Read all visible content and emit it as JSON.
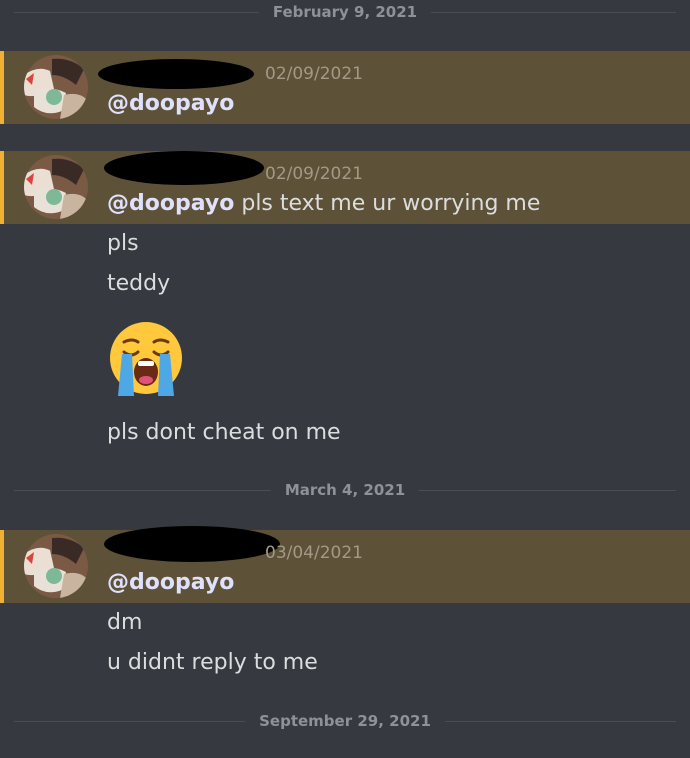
{
  "date_dividers": [
    "February 9, 2021",
    "March 4, 2021",
    "September 29, 2021"
  ],
  "messages": [
    {
      "timestamp": "02/09/2021",
      "mention": "@doopayo",
      "text": ""
    },
    {
      "timestamp": "02/09/2021",
      "mention": "@doopayo",
      "text": " pls text me ur worrying me",
      "followups": [
        "pls",
        "teddy"
      ],
      "emoji": "loudly-crying-face-icon",
      "after_emoji": "pls dont cheat on me"
    },
    {
      "timestamp": "03/04/2021",
      "mention": "@doopayo",
      "text": "",
      "followups": [
        "dm",
        "u didnt reply to me"
      ]
    }
  ],
  "colors": {
    "background": "#36393f",
    "mention_highlight": "#5d5138",
    "mention_bar": "#f0b132",
    "mention_text": "#dee0fc",
    "message_text": "#dcddde",
    "divider_text": "#8e9297"
  }
}
